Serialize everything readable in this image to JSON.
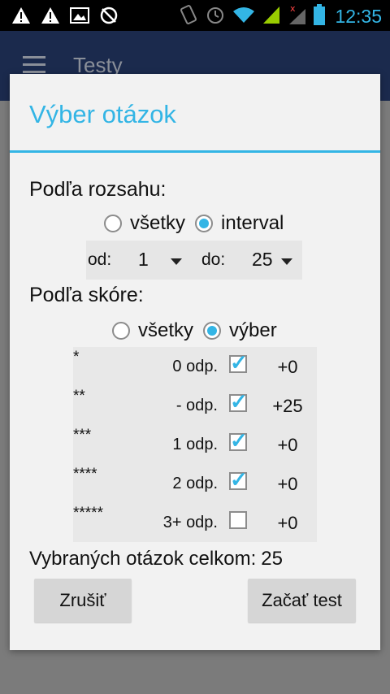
{
  "status_bar": {
    "time": "12:35",
    "left_icons": [
      "warning-icon",
      "warning-icon",
      "image-icon",
      "no-sync-icon"
    ],
    "right_icons": [
      "vibrate-icon",
      "alarm-icon",
      "wifi-icon",
      "signal-icon",
      "signal-icon",
      "battery-icon"
    ],
    "accent": "#33b5e5"
  },
  "app_bar": {
    "title": "Testy"
  },
  "dialog": {
    "title": "Výber otázok",
    "by_range": {
      "label": "Podľa rozsahu:",
      "options": [
        {
          "label": "všetky",
          "selected": false
        },
        {
          "label": "interval",
          "selected": true
        }
      ],
      "from_label": "od:",
      "from_value": "1",
      "to_label": "do:",
      "to_value": "25"
    },
    "by_score": {
      "label": "Podľa skóre:",
      "options": [
        {
          "label": "všetky",
          "selected": false
        },
        {
          "label": "výber",
          "selected": true
        }
      ],
      "rows": [
        {
          "stars": "*",
          "answers": "0 odp.",
          "checked": true,
          "points": "+0"
        },
        {
          "stars": "**",
          "answers": "- odp.",
          "checked": true,
          "points": "+25"
        },
        {
          "stars": "***",
          "answers": "1 odp.",
          "checked": true,
          "points": "+0"
        },
        {
          "stars": "****",
          "answers": "2 odp.",
          "checked": true,
          "points": "+0"
        },
        {
          "stars": "*****",
          "answers": "3+ odp.",
          "checked": false,
          "points": "+0"
        }
      ]
    },
    "total_label": "Vybraných otázok celkom:",
    "total_value": "25",
    "cancel_label": "Zrušiť",
    "start_label": "Začať test"
  }
}
